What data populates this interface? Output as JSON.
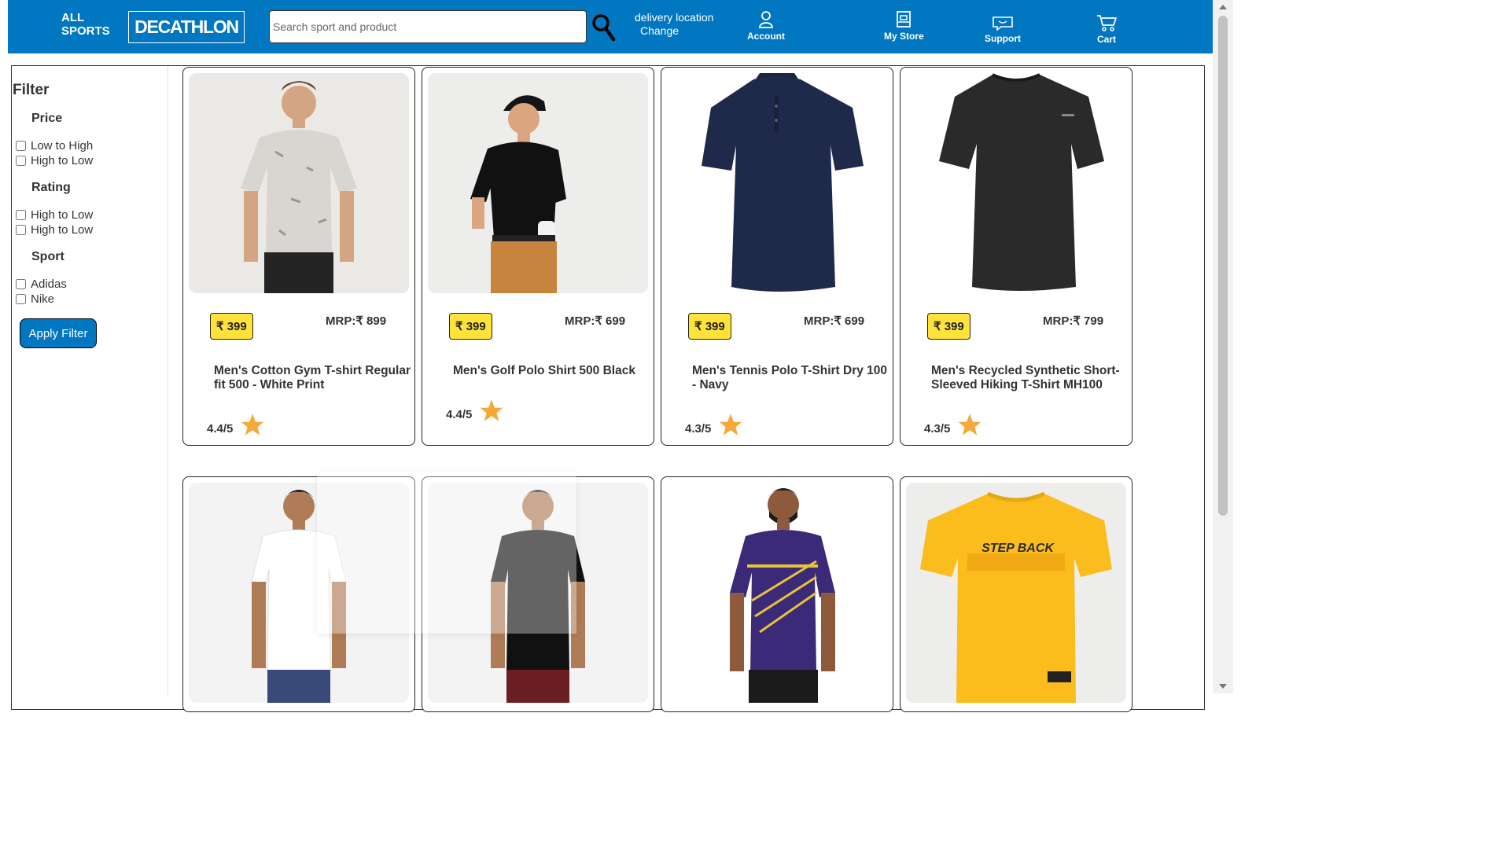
{
  "header": {
    "all_sports": "ALL SPORTS",
    "brand": "DECATHLON",
    "search_placeholder": "Search sport and product",
    "delivery_label": "delivery location",
    "delivery_change": "Change",
    "nav": {
      "account": "Account",
      "my_store": "My Store",
      "support": "Support",
      "cart": "Cart"
    }
  },
  "filter": {
    "title": "Filter",
    "price_heading": "Price",
    "price_options": [
      "Low to High",
      "High to Low"
    ],
    "rating_heading": "Rating",
    "rating_options": [
      "High to Low",
      "High to Low"
    ],
    "sport_heading": "Sport",
    "sport_options": [
      "Adidas",
      "Nike"
    ],
    "apply_label": "Apply Filter"
  },
  "products": [
    {
      "price": "₹ 399",
      "mrp": "MRP:₹ 899",
      "name": "Men's Cotton Gym T-shirt Regular fit 500 - White Print",
      "rating": "4.4/5"
    },
    {
      "price": "₹ 399",
      "mrp": "MRP:₹ 699",
      "name": "Men's Golf Polo Shirt 500 Black",
      "rating": "4.4/5"
    },
    {
      "price": "₹ 399",
      "mrp": "MRP:₹ 699",
      "name": "Men's Tennis Polo T-Shirt Dry 100 - Navy",
      "rating": "4.3/5"
    },
    {
      "price": "₹ 399",
      "mrp": "MRP:₹ 799",
      "name": "Men's Recycled Synthetic Short-Sleeved Hiking T-Shirt MH100",
      "rating": "4.3/5"
    }
  ],
  "product_images_row2": [
    "white-tshirt-model",
    "black-tshirt-model",
    "purple-jersey-model",
    "yellow-step-back-tshirt"
  ],
  "tshirt_print": "STEP BACK",
  "colors": {
    "header_bg": "#0077c0",
    "price_badge": "#ffe23a",
    "star": "#f6a839"
  }
}
